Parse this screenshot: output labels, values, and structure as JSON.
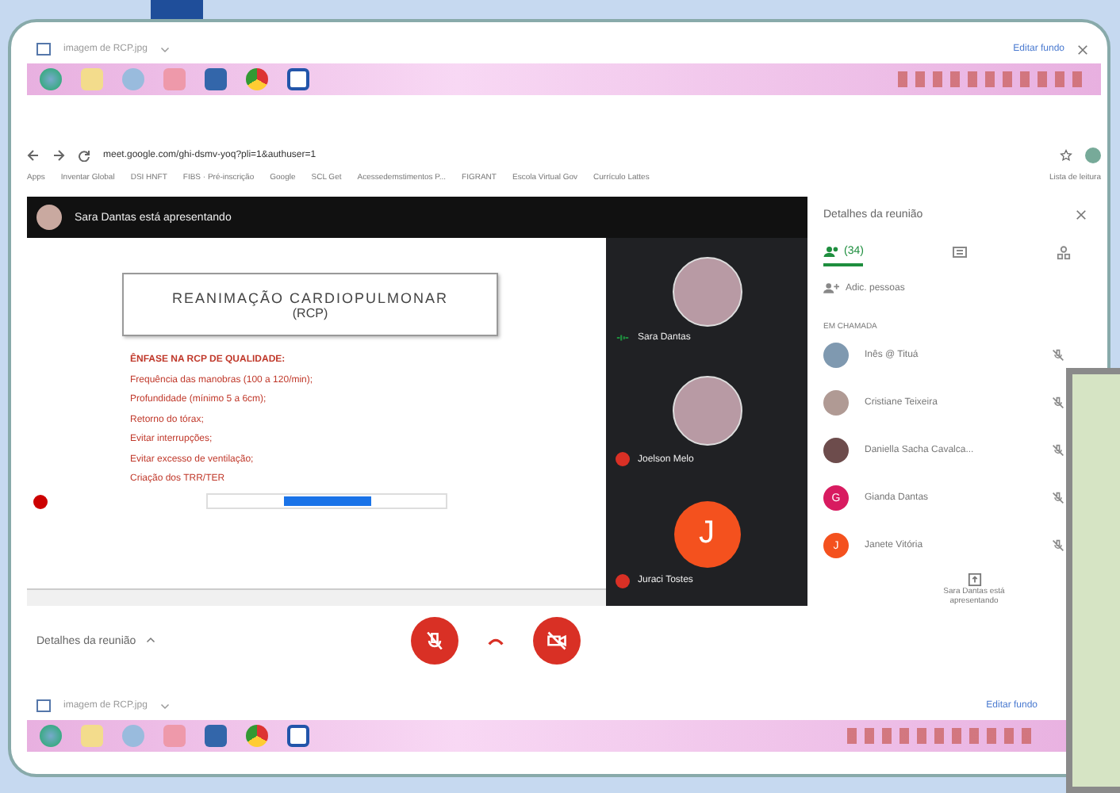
{
  "viewer_top": {
    "filename": "imagem de RCP.jpg",
    "action": "Editar fundo"
  },
  "browser": {
    "url": "meet.google.com/ghi-dsmv-yoq?pli=1&authuser=1",
    "bookmarks": [
      "Apps",
      "Inventar Global",
      "DSI HNFT",
      "FIBS · Pré-inscrição",
      "Google",
      "SCL Get",
      "Acessedemstimentos P...",
      "FIGRANT",
      "Escola Virtual Gov",
      "Currículo Lattes"
    ],
    "reading_list": "Lista de leitura"
  },
  "meet": {
    "presenter_banner": "Sara Dantas está apresentando",
    "slide": {
      "title": "REANIMAÇÃO CARDIOPULMONAR",
      "subtitle": "(RCP)",
      "bullets": [
        "ÊNFASE NA RCP DE QUALIDADE:",
        "Frequência das manobras (100 a 120/min);",
        "Profundidade (mínimo 5 a 6cm);",
        "Retorno do tórax;",
        "Evitar interrupções;",
        "Evitar excesso de ventilação;",
        "Criação dos TRR/TER"
      ]
    },
    "tiles": [
      {
        "name": "Sara Dantas",
        "kind": "photo",
        "muted": false
      },
      {
        "name": "Joelson Melo",
        "kind": "photo",
        "muted": true
      },
      {
        "name": "Juraci Tostes",
        "kind": "initial",
        "initial": "J",
        "muted": true
      }
    ],
    "details_label": "Detalhes da reunião"
  },
  "panel": {
    "title": "Detalhes da reunião",
    "people_count": "(34)",
    "add_people": "Adic. pessoas",
    "section": "EM CHAMADA",
    "participants": [
      {
        "name": "Inês @ Tituá",
        "color": "#7f99b0"
      },
      {
        "name": "Cristiane Teixeira",
        "color": "#b09a94"
      },
      {
        "name": "Daniella Sacha Cavalca...",
        "color": "#6d4c4c"
      },
      {
        "name": "Gianda Dantas",
        "color": "#d81b60",
        "initial": "G"
      },
      {
        "name": "Janete Vitória",
        "color": "#f4511e",
        "initial": "J"
      }
    ],
    "footer": "Sara Dantas está apresentando"
  },
  "viewer_bottom": {
    "filename": "imagem de RCP.jpg",
    "action": "Editar fundo"
  }
}
